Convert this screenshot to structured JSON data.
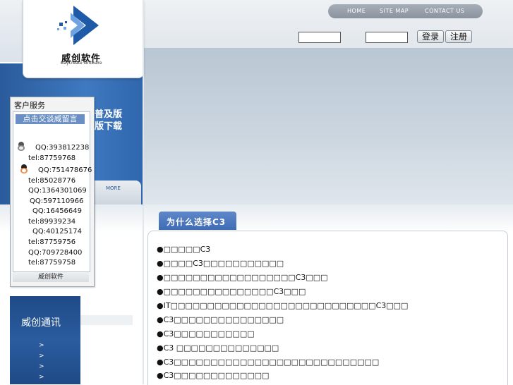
{
  "logo": {
    "cn": "威创软件",
    "en": "waycreate software"
  },
  "nav": {
    "home": "HOME",
    "sitemap": "SITE MAP",
    "contact": "CONTACT US"
  },
  "login": {
    "user_value": "",
    "pass_value": "",
    "login_btn": "登录",
    "register_btn": "注册"
  },
  "banner": {
    "line1": "普及版",
    "line2": "版下载",
    "more": "MORE"
  },
  "customer_service": {
    "title": "客户服务",
    "chat_btn": "点击交谈威留言",
    "lines": [
      "QQ:393812238",
      "tel:87759768",
      "QQ:751478676",
      "tel:85028776",
      "QQ:1364301069",
      "QQ:597110966",
      "QQ:16456649",
      "tel:89939234",
      "QQ:40125174",
      "tel:87759756",
      "QQ:709728400",
      "tel:87759758"
    ],
    "footer": "威创软件"
  },
  "comm": {
    "title": "威创通讯",
    "arrows": [
      ">",
      ">",
      ">",
      ">"
    ]
  },
  "why": {
    "title": "为什么选择C3",
    "items": [
      "●□□□□□C3",
      "●□□□□C3□□□□□□□□□□□",
      "●□□□□□□□□□□□□□□□□□□C3□□□",
      "●□□□□□□□□□□□□□□□C3□□□",
      "●IT□□□□□□□□□□□□□□□□□□□□□□□□□□□□C3□□□",
      "●C3□□□□□□□□□□□□□□□",
      "●C3□□□□□□□□□□□",
      "●C3 □□□□□□□□□□□□□□",
      "●C3□□□□□□□□□□□□□□□□□□□□□□□□□□□□",
      "●C3□□□□□□□□□□□□□"
    ]
  },
  "colors": {
    "accent_blue": "#3f6cb6",
    "nav_gray": "#8a939e"
  }
}
